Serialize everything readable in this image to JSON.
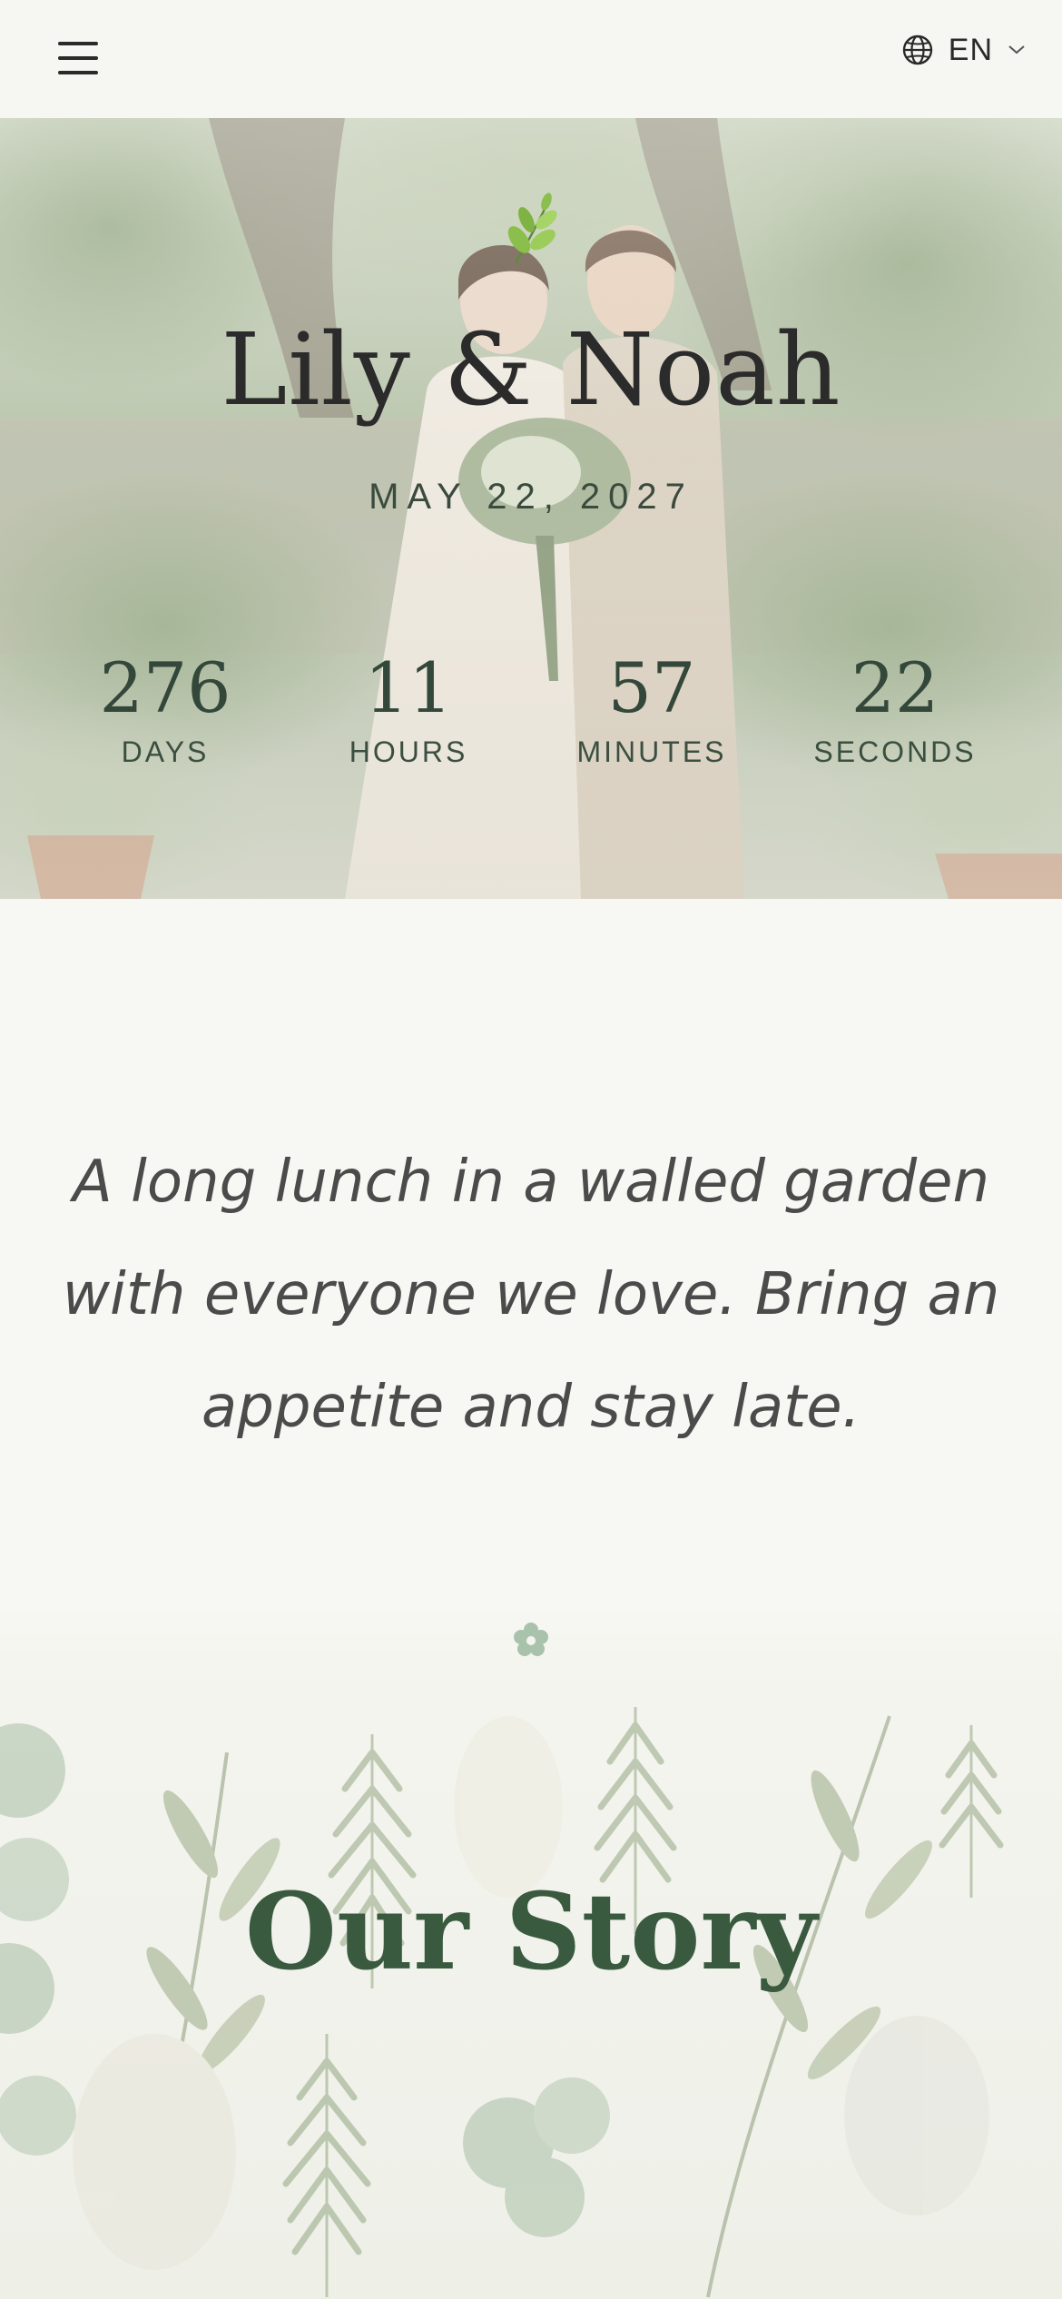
{
  "header": {
    "menu_icon": "hamburger-menu-icon",
    "language": {
      "icon": "globe-icon",
      "label": "EN",
      "chevron": "chevron-down-icon"
    }
  },
  "hero": {
    "ornament": "leaf-sprig-icon",
    "names": "Lily & Noah",
    "date": "MAY 22, 2027",
    "countdown": [
      {
        "value": "276",
        "label": "DAYS"
      },
      {
        "value": "11",
        "label": "HOURS"
      },
      {
        "value": "57",
        "label": "MINUTES"
      },
      {
        "value": "22",
        "label": "SECONDS"
      }
    ]
  },
  "intro": {
    "lines": [
      "A long lunch in a walled garden",
      "with everyone we love. Bring an",
      "appetite and stay late."
    ]
  },
  "divider": {
    "icon": "flower-icon"
  },
  "story": {
    "title": "Our Story"
  },
  "colors": {
    "page_bg": "#f7f7f3",
    "accent_green": "#3a5a3f",
    "text_dark": "#2b2b2b",
    "text_body": "#4b4b4b"
  }
}
